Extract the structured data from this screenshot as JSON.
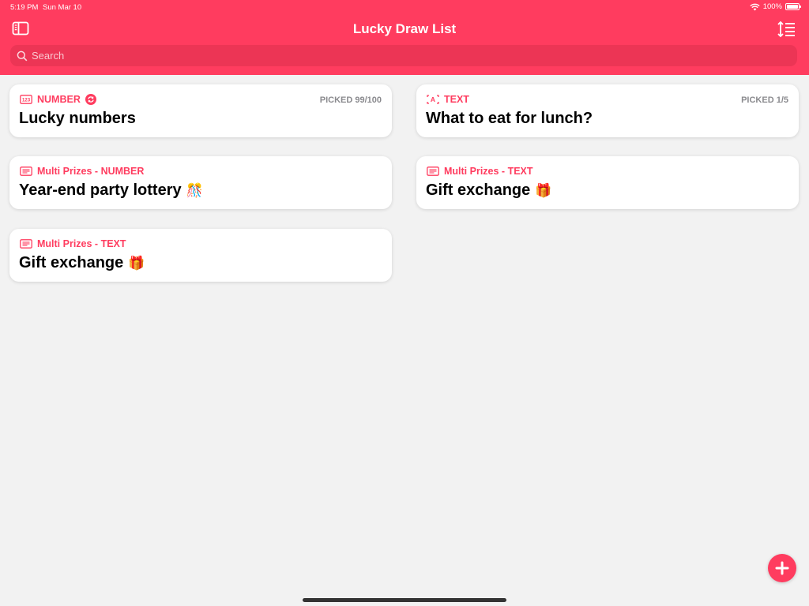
{
  "status_bar": {
    "time": "5:19 PM",
    "date": "Sun Mar 10",
    "battery": "100%"
  },
  "nav": {
    "title": "Lucky Draw List"
  },
  "search": {
    "placeholder": "Search"
  },
  "colors": {
    "accent": "#ff3c5f",
    "background": "#f2f2f2"
  },
  "cards": [
    {
      "type_icon": "number-icon",
      "type_label": "NUMBER",
      "has_repeat": true,
      "picked": "PICKED 99/100",
      "title": "Lucky numbers",
      "emoji": ""
    },
    {
      "type_icon": "text-icon",
      "type_label": "TEXT",
      "has_repeat": false,
      "picked": "PICKED 1/5",
      "title": "What to eat for lunch?",
      "emoji": ""
    },
    {
      "type_icon": "list-icon",
      "type_label": "Multi Prizes - NUMBER",
      "has_repeat": false,
      "picked": "",
      "title": "Year-end party lottery",
      "emoji": "🎊"
    },
    {
      "type_icon": "list-icon",
      "type_label": "Multi Prizes - TEXT",
      "has_repeat": false,
      "picked": "",
      "title": "Gift exchange",
      "emoji": "🎁"
    },
    {
      "type_icon": "list-icon",
      "type_label": "Multi Prizes - TEXT",
      "has_repeat": false,
      "picked": "",
      "title": "Gift exchange",
      "emoji": "🎁"
    }
  ]
}
